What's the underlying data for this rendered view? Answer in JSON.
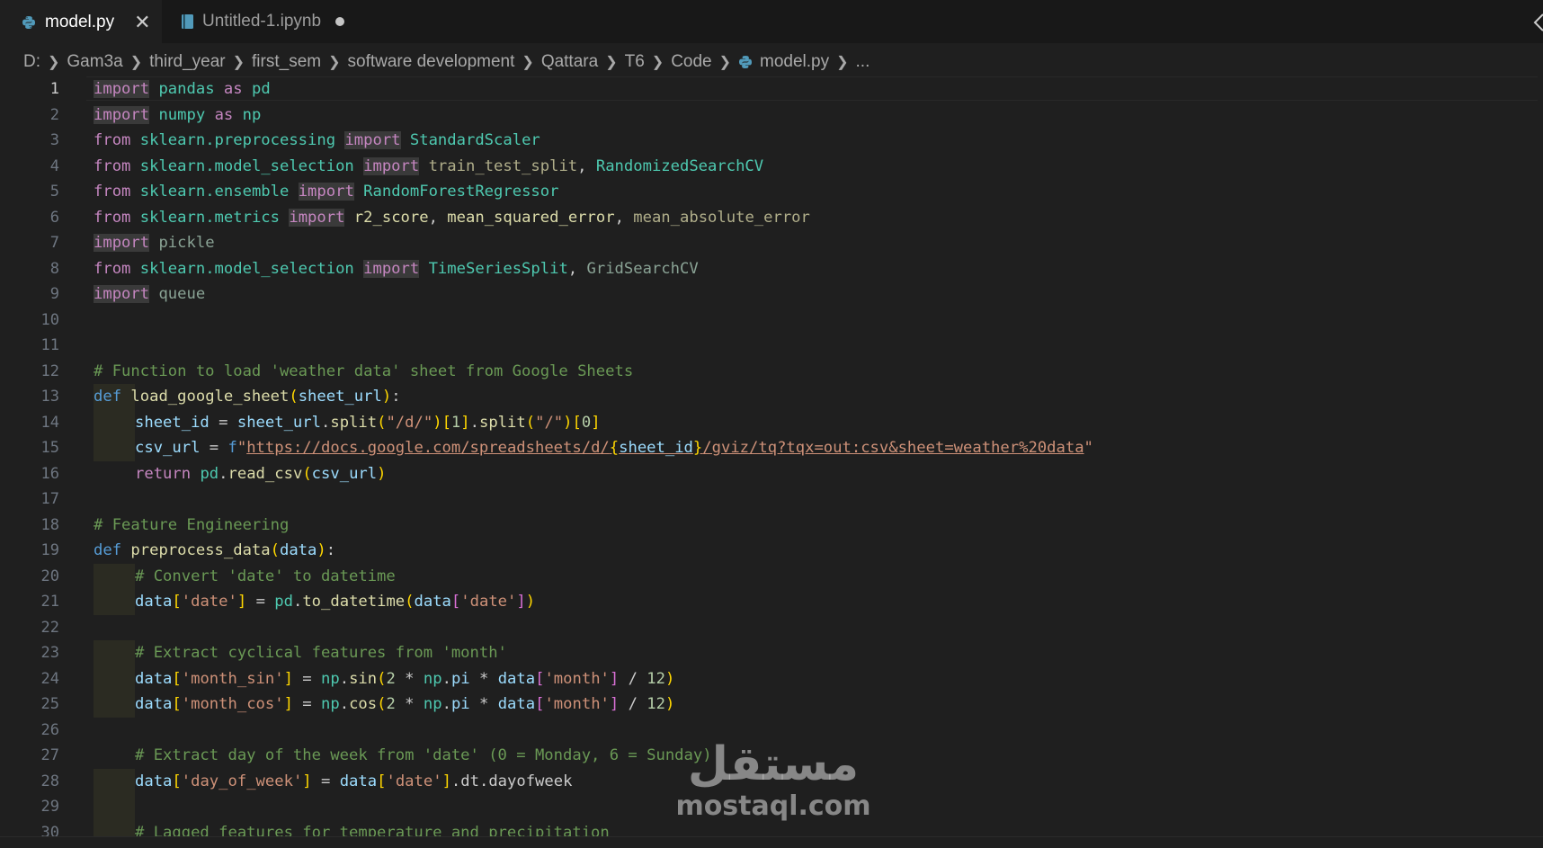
{
  "tabs": [
    {
      "label": "model.py",
      "active": true,
      "icon": "python-icon",
      "close": "✕"
    },
    {
      "label": "Untitled-1.ipynb",
      "active": false,
      "icon": "notebook-icon",
      "modified": true
    }
  ],
  "breadcrumb": [
    "D:",
    "Gam3a",
    "third_year",
    "first_sem",
    "software development",
    "Qattara",
    "T6",
    "Code",
    "model.py",
    "..."
  ],
  "line_numbers": [
    "1",
    "2",
    "3",
    "4",
    "5",
    "6",
    "7",
    "8",
    "9",
    "10",
    "11",
    "12",
    "13",
    "14",
    "15",
    "16",
    "17",
    "18",
    "19",
    "20",
    "21",
    "22",
    "23",
    "24",
    "25",
    "26",
    "27",
    "28",
    "29",
    "30"
  ],
  "active_line": "1",
  "code": {
    "import": "import",
    "from": "from",
    "as": "as",
    "def": "def",
    "return": "return",
    "l1": {
      "mod": "pandas",
      "alias": "pd"
    },
    "l2": {
      "mod": "numpy",
      "alias": "np"
    },
    "l3": {
      "mod": "sklearn.preprocessing",
      "name": "StandardScaler"
    },
    "l4": {
      "mod": "sklearn.model_selection",
      "n1": "train_test_split",
      "sep": ", ",
      "n2": "RandomizedSearchCV"
    },
    "l5": {
      "mod": "sklearn.ensemble",
      "name": "RandomForestRegressor"
    },
    "l6": {
      "mod": "sklearn.metrics",
      "n1": "r2_score",
      "n2": "mean_squared_error",
      "n3": "mean_absolute_error"
    },
    "l7": {
      "mod": "pickle"
    },
    "l8": {
      "mod": "sklearn.model_selection",
      "n1": "TimeSeriesSplit",
      "n2": "GridSearchCV"
    },
    "l9": {
      "mod": "queue"
    },
    "l12": "# Function to load 'weather data' sheet from Google Sheets",
    "l13": {
      "fn": "load_google_sheet",
      "param": "sheet_url"
    },
    "l14": {
      "var": "sheet_id",
      "eq": " = ",
      "obj": "sheet_url",
      "split": "split",
      "s1": "\"/d/\"",
      "i1": "1",
      "s2": "\"/\"",
      "i2": "0"
    },
    "l15": {
      "var": "csv_url",
      "eq": " = ",
      "f": "f",
      "q": "\"",
      "url1": "https://docs.google.com/spreadsheets/d/",
      "lb": "{",
      "inner": "sheet_id",
      "rb": "}",
      "url2": "/gviz/tq?tqx=out:csv&sheet=weather%20data"
    },
    "l16": {
      "mod": "pd",
      "fn": "read_csv",
      "arg": "csv_url"
    },
    "l18": "# Feature Engineering",
    "l19": {
      "fn": "preprocess_data",
      "param": "data"
    },
    "l20": "# Convert 'date' to datetime",
    "l21": {
      "var": "data",
      "key": "'date'",
      "mod": "pd",
      "fn": "to_datetime"
    },
    "l23": "# Extract cyclical features from 'month'",
    "l24": {
      "key": "'month_sin'",
      "fn": "sin",
      "two": "2",
      "pi": "pi",
      "key2": "'month'",
      "twelve": "12"
    },
    "l25": {
      "key": "'month_cos'",
      "fn": "cos"
    },
    "l27": "# Extract day of the week from 'date' (0 = Monday, 6 = Sunday)",
    "l28": {
      "key": "'day_of_week'",
      "tail": ".dt.dayofweek"
    },
    "l30": "# Lagged features for temperature and precipitation"
  },
  "watermark": {
    "arabic": "مستقل",
    "latin": "mostaql.com"
  }
}
